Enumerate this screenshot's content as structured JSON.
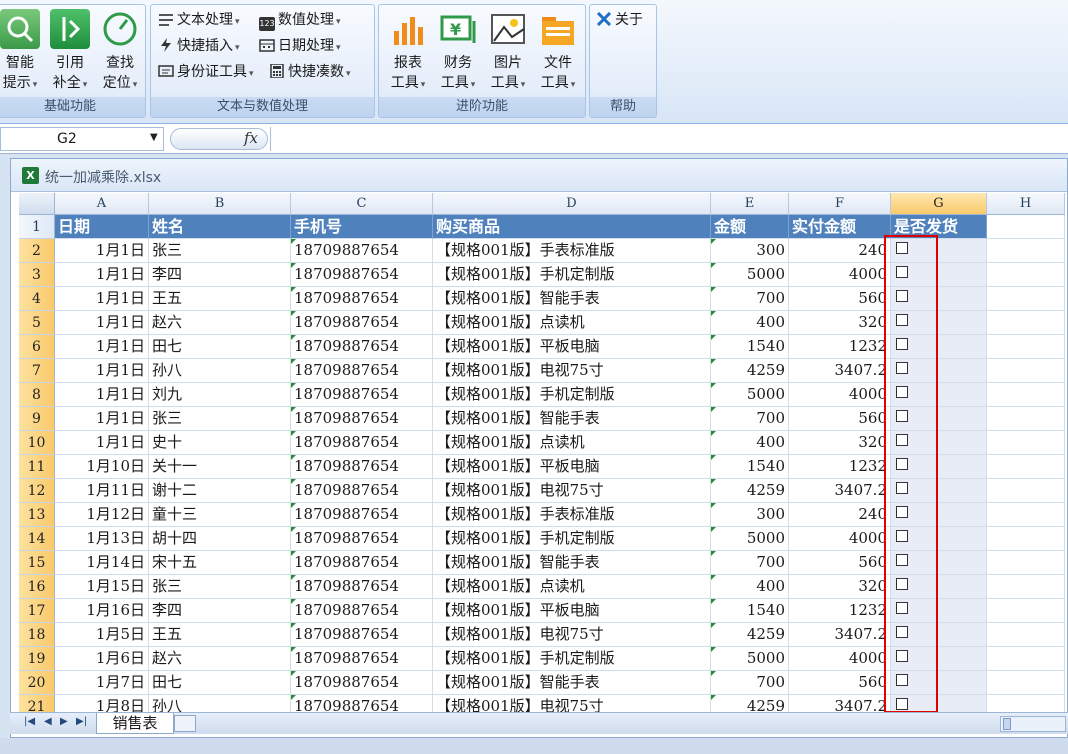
{
  "ribbon": {
    "groups": [
      {
        "label": "基础功能"
      },
      {
        "label": "文本与数值处理"
      },
      {
        "label": "进阶功能"
      },
      {
        "label": "帮助"
      }
    ],
    "basic": [
      {
        "line1": "智能",
        "line2": "提示"
      },
      {
        "line1": "引用",
        "line2": "补全"
      },
      {
        "line1": "查找",
        "line2": "定位"
      }
    ],
    "text_tools": [
      {
        "label": "文本处理",
        "icon": "text-lines-icon"
      },
      {
        "label": "数值处理",
        "icon": "numeric-123-icon"
      },
      {
        "label": "快捷插入",
        "icon": "lightning-icon"
      },
      {
        "label": "日期处理",
        "icon": "calendar-icon"
      },
      {
        "label": "身份证工具",
        "icon": "id-card-icon"
      },
      {
        "label": "快捷凑数",
        "icon": "calculator-icon"
      }
    ],
    "advanced": [
      {
        "line1": "报表",
        "line2": "工具"
      },
      {
        "line1": "财务",
        "line2": "工具"
      },
      {
        "line1": "图片",
        "line2": "工具"
      },
      {
        "line1": "文件",
        "line2": "工具"
      }
    ],
    "about_label": "关于"
  },
  "formula_bar": {
    "name_box": "G2",
    "fx": "fx",
    "formula": ""
  },
  "workbook": {
    "filename": "统一加减乘除.xlsx"
  },
  "columns": [
    "A",
    "B",
    "C",
    "D",
    "E",
    "F",
    "G",
    "H"
  ],
  "header_row": [
    "日期",
    "姓名",
    "手机号",
    "购买商品",
    "金额",
    "实付金额",
    "是否发货"
  ],
  "rows": [
    [
      "1月1日",
      "张三",
      "18709887654",
      "【规格001版】手表标准版",
      "300",
      "240"
    ],
    [
      "1月1日",
      "李四",
      "18709887654",
      "【规格001版】手机定制版",
      "5000",
      "4000"
    ],
    [
      "1月1日",
      "王五",
      "18709887654",
      "【规格001版】智能手表",
      "700",
      "560"
    ],
    [
      "1月1日",
      "赵六",
      "18709887654",
      "【规格001版】点读机",
      "400",
      "320"
    ],
    [
      "1月1日",
      "田七",
      "18709887654",
      "【规格001版】平板电脑",
      "1540",
      "1232"
    ],
    [
      "1月1日",
      "孙八",
      "18709887654",
      "【规格001版】电视75寸",
      "4259",
      "3407.2"
    ],
    [
      "1月1日",
      "刘九",
      "18709887654",
      "【规格001版】手机定制版",
      "5000",
      "4000"
    ],
    [
      "1月1日",
      "张三",
      "18709887654",
      "【规格001版】智能手表",
      "700",
      "560"
    ],
    [
      "1月1日",
      "史十",
      "18709887654",
      "【规格001版】点读机",
      "400",
      "320"
    ],
    [
      "1月10日",
      "关十一",
      "18709887654",
      "【规格001版】平板电脑",
      "1540",
      "1232"
    ],
    [
      "1月11日",
      "谢十二",
      "18709887654",
      "【规格001版】电视75寸",
      "4259",
      "3407.2"
    ],
    [
      "1月12日",
      "童十三",
      "18709887654",
      "【规格001版】手表标准版",
      "300",
      "240"
    ],
    [
      "1月13日",
      "胡十四",
      "18709887654",
      "【规格001版】手机定制版",
      "5000",
      "4000"
    ],
    [
      "1月14日",
      "宋十五",
      "18709887654",
      "【规格001版】智能手表",
      "700",
      "560"
    ],
    [
      "1月15日",
      "张三",
      "18709887654",
      "【规格001版】点读机",
      "400",
      "320"
    ],
    [
      "1月16日",
      "李四",
      "18709887654",
      "【规格001版】平板电脑",
      "1540",
      "1232"
    ],
    [
      "1月5日",
      "王五",
      "18709887654",
      "【规格001版】电视75寸",
      "4259",
      "3407.2"
    ],
    [
      "1月6日",
      "赵六",
      "18709887654",
      "【规格001版】手机定制版",
      "5000",
      "4000"
    ],
    [
      "1月7日",
      "田七",
      "18709887654",
      "【规格001版】智能手表",
      "700",
      "560"
    ],
    [
      "1月8日",
      "孙八",
      "18709887654",
      "【规格001版】电视75寸",
      "4259",
      "3407.2"
    ]
  ],
  "sheet_tab": "销售表",
  "colors": {
    "header_fill": "#4f81bd",
    "selected_col": "#f9c96a",
    "annotation_box": "#e00000"
  }
}
